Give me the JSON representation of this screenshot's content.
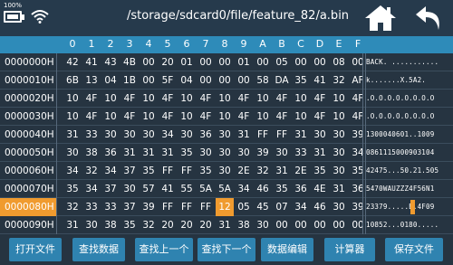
{
  "status": {
    "battery_label": "100%"
  },
  "header": {
    "path": "/storage/sdcard0/file/feature_82/a.bin"
  },
  "icons": {
    "home": "home-icon",
    "back": "back-arrow-icon",
    "wifi": "wifi-icon",
    "battery": "battery-icon"
  },
  "colors": {
    "accent": "#2e8bb9",
    "selection": "#f09b2f",
    "background": "#263441"
  },
  "columns": [
    "0",
    "1",
    "2",
    "3",
    "4",
    "5",
    "6",
    "7",
    "8",
    "9",
    "A",
    "B",
    "C",
    "D",
    "E",
    "F"
  ],
  "rows": [
    {
      "address": "0000000H",
      "bytes": [
        "42",
        "41",
        "43",
        "4B",
        "00",
        "20",
        "01",
        "00",
        "00",
        "01",
        "00",
        "05",
        "00",
        "00",
        "08",
        "00"
      ],
      "ascii": "BACK. ..........."
    },
    {
      "address": "0000010H",
      "bytes": [
        "6B",
        "13",
        "04",
        "1B",
        "00",
        "5F",
        "04",
        "00",
        "00",
        "00",
        "58",
        "DA",
        "35",
        "41",
        "32",
        "AF"
      ],
      "ascii": "k.......X.5A2."
    },
    {
      "address": "0000020H",
      "bytes": [
        "10",
        "4F",
        "10",
        "4F",
        "10",
        "4F",
        "10",
        "4F",
        "10",
        "4F",
        "10",
        "4F",
        "10",
        "4F",
        "10",
        "4F"
      ],
      "ascii": ".O.O.O.O.O.O.O.O"
    },
    {
      "address": "0000030H",
      "bytes": [
        "10",
        "4F",
        "10",
        "4F",
        "10",
        "4F",
        "10",
        "4F",
        "10",
        "4F",
        "10",
        "4F",
        "10",
        "4F",
        "10",
        "4F"
      ],
      "ascii": ".O.O.O.O.O.O.O.O"
    },
    {
      "address": "0000040H",
      "bytes": [
        "31",
        "33",
        "30",
        "30",
        "30",
        "34",
        "30",
        "36",
        "30",
        "31",
        "FF",
        "FF",
        "31",
        "30",
        "30",
        "39"
      ],
      "ascii": "1300040601..1009"
    },
    {
      "address": "0000050H",
      "bytes": [
        "30",
        "38",
        "36",
        "31",
        "31",
        "31",
        "35",
        "30",
        "30",
        "30",
        "39",
        "30",
        "33",
        "31",
        "30",
        "34"
      ],
      "ascii": "0861115000903104"
    },
    {
      "address": "0000060H",
      "bytes": [
        "34",
        "32",
        "34",
        "37",
        "35",
        "FF",
        "FF",
        "35",
        "30",
        "2E",
        "32",
        "31",
        "2E",
        "35",
        "30",
        "35"
      ],
      "ascii": "42475...50.21.505"
    },
    {
      "address": "0000070H",
      "bytes": [
        "35",
        "34",
        "37",
        "30",
        "57",
        "41",
        "55",
        "5A",
        "5A",
        "34",
        "46",
        "35",
        "36",
        "4E",
        "31",
        "36"
      ],
      "ascii": "5470WAUZZZ4F56N1"
    },
    {
      "address": "0000080H",
      "bytes": [
        "32",
        "33",
        "33",
        "37",
        "39",
        "FF",
        "FF",
        "FF",
        "12",
        "05",
        "45",
        "07",
        "34",
        "46",
        "30",
        "39"
      ],
      "ascii": "23379.....E.4F09"
    },
    {
      "address": "0000090H",
      "bytes": [
        "31",
        "30",
        "38",
        "35",
        "32",
        "20",
        "20",
        "20",
        "31",
        "38",
        "30",
        "00",
        "00",
        "00",
        "00",
        "00"
      ],
      "ascii": "10852...0180....."
    }
  ],
  "selection": {
    "row": 8,
    "byte": 8
  },
  "toolbar": {
    "buttons": [
      "打开文件",
      "查找数据",
      "查找上一个",
      "查找下一个",
      "数据编辑",
      "计算器",
      "保存文件"
    ]
  }
}
